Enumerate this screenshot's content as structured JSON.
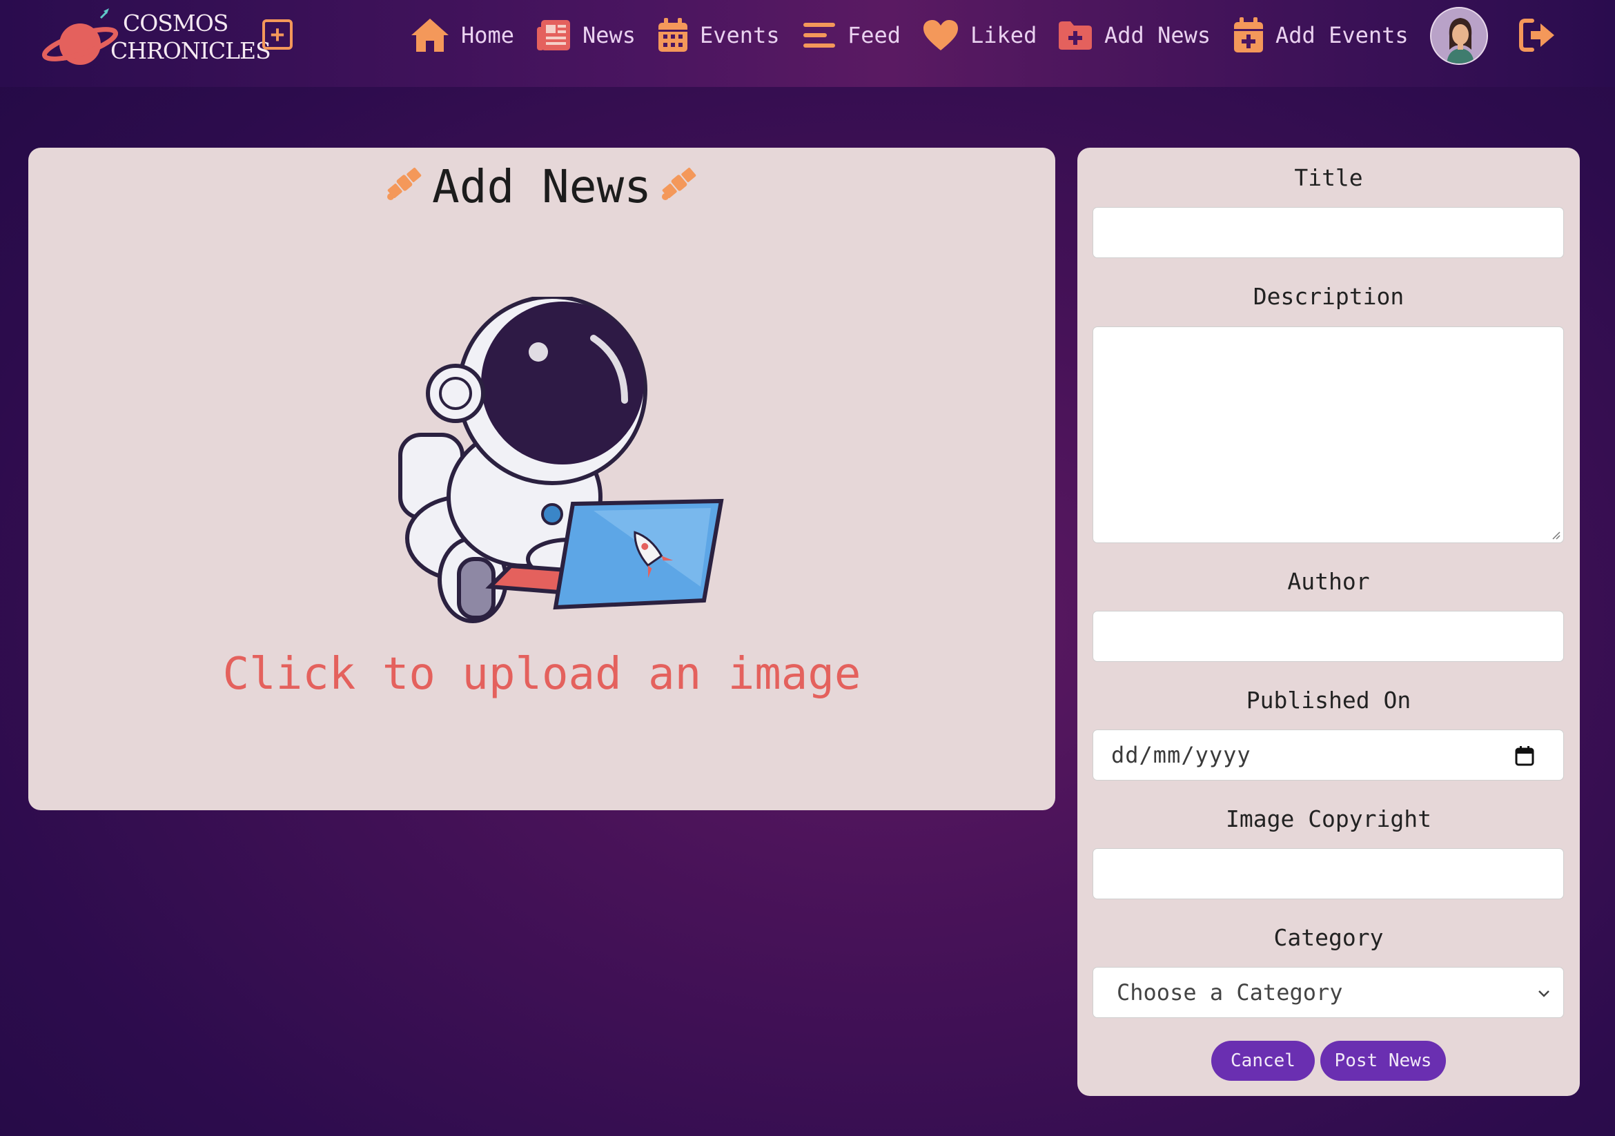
{
  "app": {
    "logo_line1": "COSMOS",
    "logo_line2": "CHRONICLES"
  },
  "nav": {
    "add_icon": "plus-square-icon",
    "items": [
      {
        "label": "Home",
        "icon": "house-icon"
      },
      {
        "label": "News",
        "icon": "newspaper-icon"
      },
      {
        "label": "Events",
        "icon": "calendar-icon"
      },
      {
        "label": "Feed",
        "icon": "bars-icon"
      },
      {
        "label": "Liked",
        "icon": "heart-icon"
      },
      {
        "label": "Add News",
        "icon": "folder-plus-icon"
      },
      {
        "label": "Add Events",
        "icon": "calendar-plus-icon"
      }
    ],
    "logout_icon": "sign-out-icon"
  },
  "upload": {
    "title": "Add News",
    "prompt": "Click to upload an image"
  },
  "form": {
    "title_label": "Title",
    "description_label": "Description",
    "author_label": "Author",
    "published_label": "Published On",
    "published_placeholder": "dd/mm/yyyy",
    "copyright_label": "Image Copyright",
    "category_label": "Category",
    "category_selected": "Choose a Category",
    "cancel_label": "Cancel",
    "submit_label": "Post News"
  },
  "colors": {
    "accent_orange": "#f4985a",
    "upload_red": "#e4615d",
    "button_purple": "#6a2fb1",
    "card_bg": "#e6d7d8"
  }
}
